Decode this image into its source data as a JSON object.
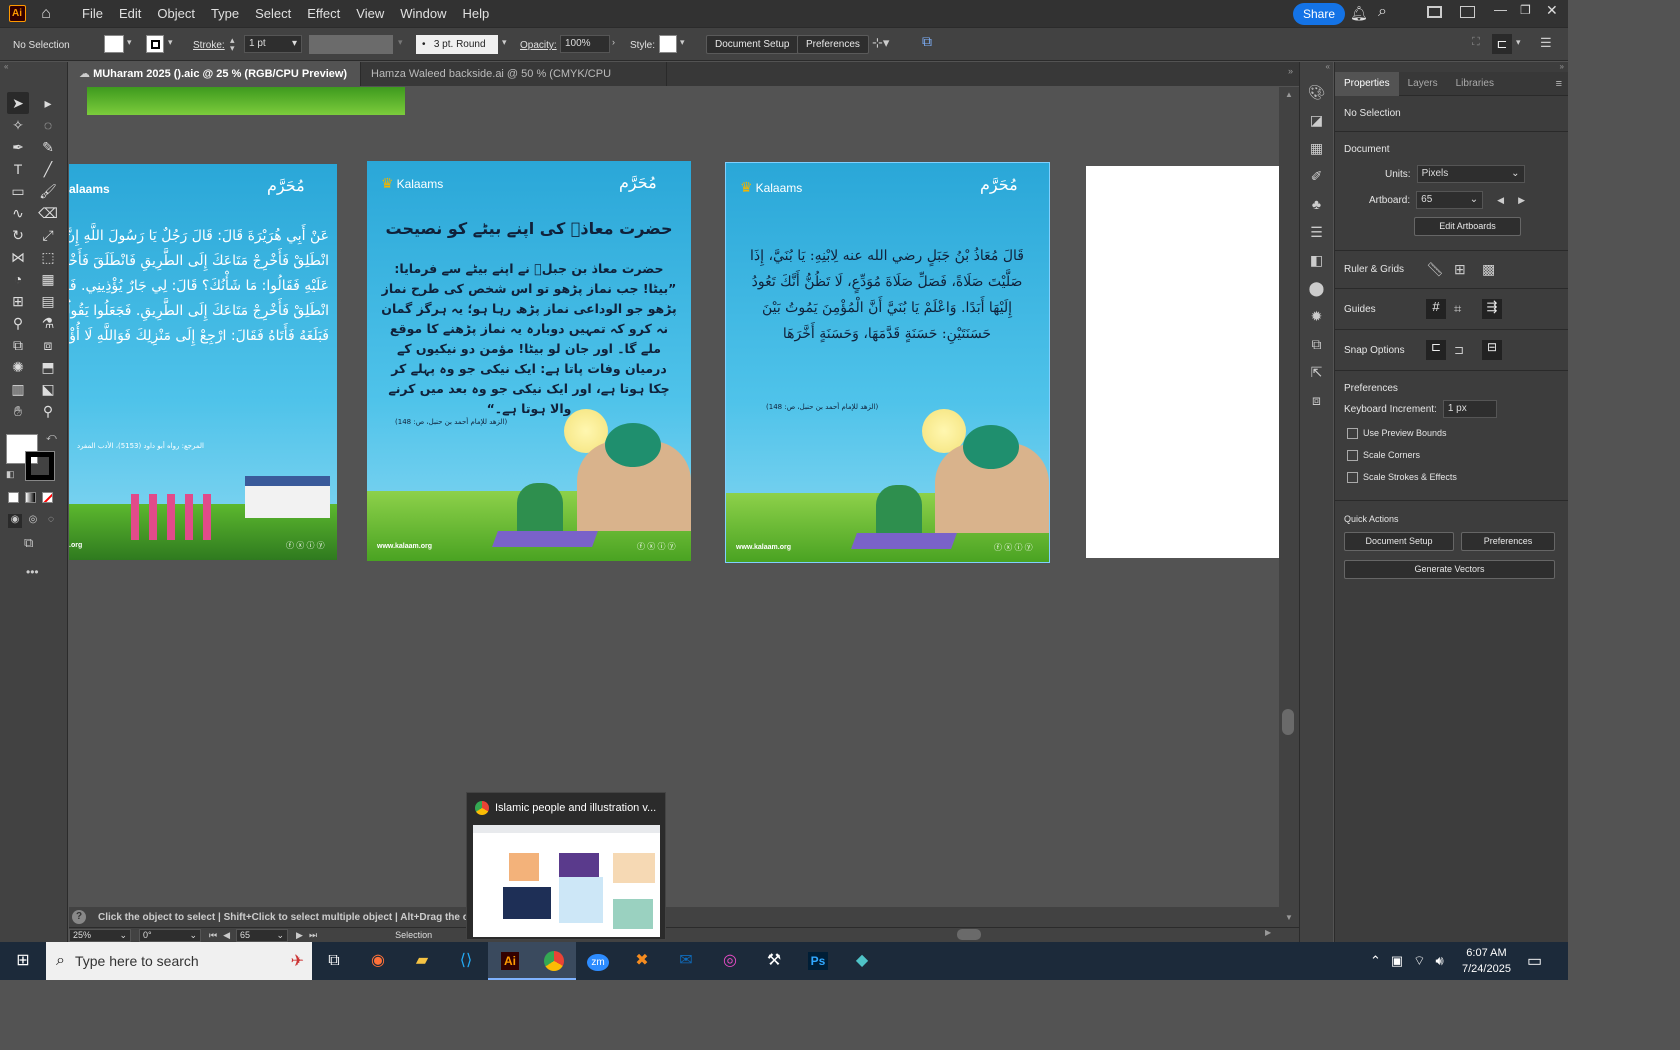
{
  "menu": {
    "app_logo": "Ai",
    "items": [
      "File",
      "Edit",
      "Object",
      "Type",
      "Select",
      "Effect",
      "View",
      "Window",
      "Help"
    ],
    "share": "Share"
  },
  "control": {
    "selection": "No Selection",
    "stroke_label": "Stroke:",
    "stroke_value": "1 pt",
    "brush": "3 pt. Round",
    "opacity_label": "Opacity:",
    "opacity_value": "100%",
    "style_label": "Style:",
    "doc_setup": "Document Setup",
    "preferences": "Preferences"
  },
  "tabs": [
    {
      "label": "MUharam 2025 ().aic @ 25 % (RGB/CPU Preview)",
      "close": "×"
    },
    {
      "label": "Hamza Waleed backside.ai @ 50 % (CMYK/CPU Preview)",
      "close": "×"
    }
  ],
  "artboards": {
    "brand": "Kalaams",
    "brand_partial": "alaams",
    "muharram": "مُحَرَّم",
    "site": "www.kalaam.org",
    "ab1": {
      "arabic": "عَنْ أَبِي هُرَيْرَةَ قَالَ: قَالَ رَجُلٌ يَا رَسُولَ اللَّهِ إِنَّ لِي جَارًا يُؤْذِينِي. فَقَالَ: انْطَلِقْ فَأَخْرِجْ مَتَاعَكَ إِلَى الطَّرِيقِ فَانْطَلَقَ فَأَخْرَجَ مَتَاعَهُ. فَاجْتَمَعَ النَّاسُ عَلَيْهِ فَقَالُوا: مَا شَأْنُكَ؟ قَالَ: لِي جَارٌ يُؤْذِينِي. فَذَكَرْتُ لِلنَّبِيِّ ﷺ فَقَالَ: انْطَلِقْ فَأَخْرِجْ مَتَاعَكَ إِلَى الطَّرِيقِ. فَجَعَلُوا يَقُولُونَ: اللَّهُمَّ الْعَنْهُ اللَّهُمَّ أَخْزِهِ. فَبَلَغَهُ فَأَتَاهُ فَقَالَ: ارْجِعْ إِلَى مَنْزِلِكَ فَوَاللَّهِ لَا أُؤْذِيكَ أَبَدًا.",
      "ref": "المرجع: رواه أبو داود (5153)، الأدب المفرد"
    },
    "ab2": {
      "title": "حضرت معاذؓ کی اپنے بیٹے کو نصیحت",
      "body": "حضرت معاذ بن جبلؓ نے اپنے بیٹے سے فرمایا: ”بیٹا! جب نماز پڑھو تو اس شخص کی طرح نماز پڑھو جو الوداعی نماز پڑھ رہا ہو؛ یہ ہرگز گمان نہ کرو کہ تمہیں دوبارہ یہ نماز پڑھنے کا موقع ملے گا۔ اور جان لو بیٹا! مؤمن دو نیکیوں کے درمیان وفات پاتا ہے: ایک نیکی جو وہ پہلے کر چکا ہوتا ہے، اور ایک نیکی جو وہ بعد میں کرنے والا ہوتا ہے۔“",
      "ref": "(الزهد للإمام أحمد بن حنبل، ص: 148)"
    },
    "ab3": {
      "arabic": "قَالَ مُعَاذُ بْنُ جَبَلٍ رضي الله عنه لِابْنِهِ: يَا بُنَيَّ، إِذَا صَلَّيْتَ صَلَاةً، فَصَلِّ صَلَاةَ مُوَدِّعٍ، لَا تَظُنُّ أَنَّكَ تَعُودُ إِلَيْهَا أَبَدًا. وَاعْلَمْ يَا بُنَيَّ أَنَّ الْمُؤْمِنَ يَمُوتُ بَيْنَ حَسَنَتَيْنِ: حَسَنَةٍ قَدَّمَهَا، وَحَسَنَةٍ أَخَّرَهَا",
      "ref": "(الزهد للإمام أحمد بن حنبل، ص: 148)"
    }
  },
  "properties": {
    "tabs": [
      "Properties",
      "Layers",
      "Libraries"
    ],
    "no_selection": "No Selection",
    "document": "Document",
    "units_label": "Units:",
    "units_value": "Pixels",
    "artboard_label": "Artboard:",
    "artboard_value": "65",
    "edit_artboards": "Edit Artboards",
    "ruler_grids": "Ruler & Grids",
    "guides": "Guides",
    "snap_options": "Snap Options",
    "preferences": "Preferences",
    "keyboard_increment_label": "Keyboard Increment:",
    "keyboard_increment_value": "1 px",
    "use_preview_bounds": "Use Preview Bounds",
    "scale_corners": "Scale Corners",
    "scale_strokes": "Scale Strokes & Effects",
    "quick_actions": "Quick Actions",
    "doc_setup": "Document Setup",
    "prefs_btn": "Preferences",
    "generate_vectors": "Generate Vectors"
  },
  "status": {
    "hint": "Click the object to select  |  Shift+Click to select multiple object  |  Alt+Drag the obje",
    "zoom": "25%",
    "rotation": "0°",
    "artboard": "65",
    "tool": "Selection"
  },
  "popup": {
    "title": "Islamic people and illustration v..."
  },
  "taskbar": {
    "search": "Type here to search",
    "time": "6:07 AM",
    "date": "7/24/2025",
    "ps": "Ps",
    "ai": "Ai",
    "zoom": "zm"
  },
  "colors": {
    "accent": "#1473e6",
    "sky": "#2aa7d8",
    "grass": "#5cb82e"
  }
}
